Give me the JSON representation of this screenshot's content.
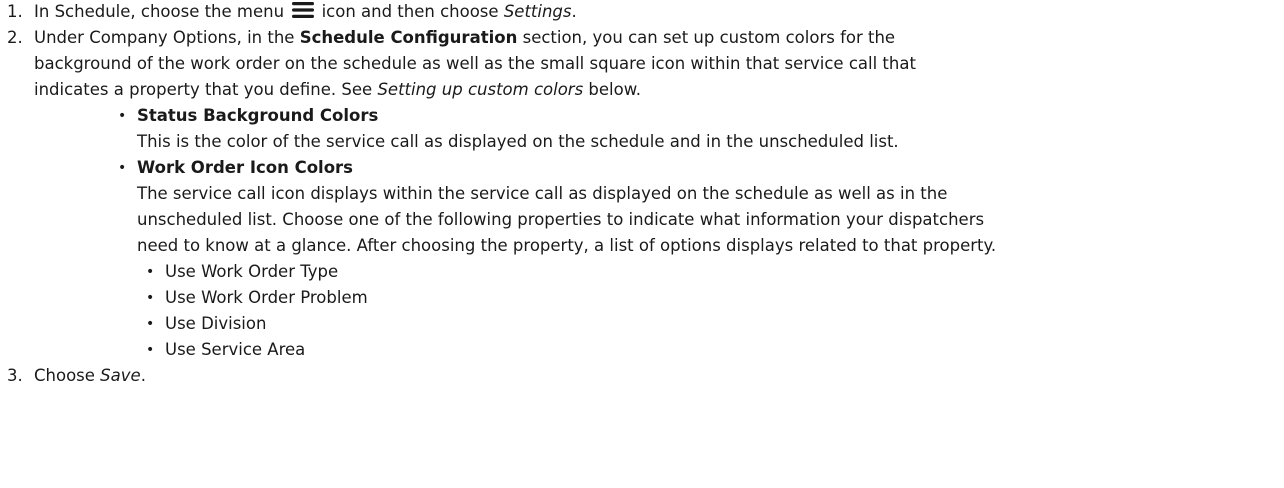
{
  "steps": [
    {
      "num": "1.",
      "text_a": "In Schedule, choose the menu",
      "icon": "hamburger-menu-icon",
      "text_b": "icon and then choose",
      "emph": "Settings",
      "text_c": "."
    },
    {
      "num": "2.",
      "line1_a": "Under Company Options, in the",
      "line1_bold": "Schedule Configuration",
      "line1_b": "section, you can set up custom colors for the",
      "line2": "background of the work order on the schedule as well as the small square icon within that service call that",
      "line3_a": "indicates a property that you define. See",
      "line3_emph": "Setting up custom colors",
      "line3_b": "below.",
      "options": [
        {
          "title": "Status Background Colors",
          "lines": [
            "This is the color of the service call as displayed on the schedule and in the unscheduled list."
          ]
        },
        {
          "title": "Work Order Icon Colors",
          "lines": [
            "The service call icon displays within the service call as displayed on the schedule as well as in the",
            "unscheduled list. Choose one of the following properties to indicate what information your dispatchers",
            "need to know at a glance. After choosing the property, a list of options displays related to that property."
          ],
          "sub": [
            "Use Work Order Type",
            "Use Work Order Problem",
            "Use Division",
            "Use Service Area"
          ]
        }
      ]
    },
    {
      "num": "3.",
      "text_a": "Choose",
      "emph": "Save",
      "text_c": "."
    }
  ]
}
